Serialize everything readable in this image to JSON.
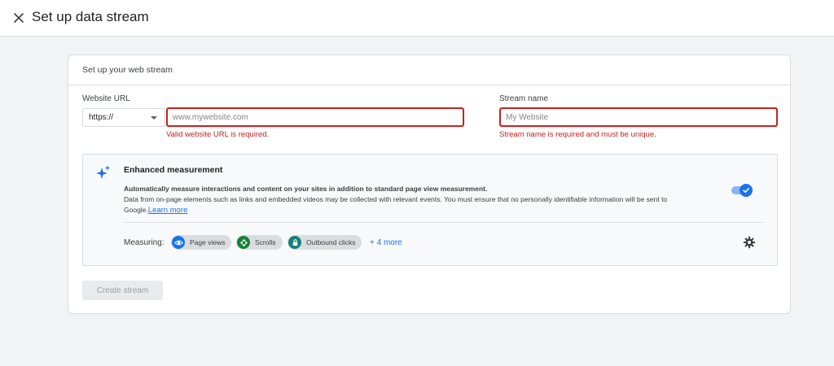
{
  "header": {
    "title": "Set up data stream",
    "close_icon": "close-icon"
  },
  "card": {
    "title": "Set up your web stream",
    "website_url": {
      "label": "Website URL",
      "protocol": "https://",
      "placeholder": "www.mywebsite.com",
      "error": "Valid website URL is required."
    },
    "stream_name": {
      "label": "Stream name",
      "placeholder": "My Website",
      "error": "Stream name is required and must be unique."
    },
    "enhanced": {
      "title": "Enhanced measurement",
      "desc_bold": "Automatically measure interactions and content on your sites in addition to standard page view measurement.",
      "desc": "Data from on-page elements such as links and embedded videos may be collected with relevant events. You must ensure that no personally identifiable information will be sent to Google.",
      "learn_more": "Learn more",
      "toggle_on": true,
      "measuring_label": "Measuring:",
      "chips": [
        {
          "label": "Page views",
          "icon": "eye-icon",
          "color": "#1a73e8"
        },
        {
          "label": "Scrolls",
          "icon": "scroll-icon",
          "color": "#188038"
        },
        {
          "label": "Outbound clicks",
          "icon": "lock-icon",
          "color": "#12837a"
        }
      ],
      "more": "+ 4 more"
    },
    "create_button": "Create stream"
  },
  "colors": {
    "error": "#c5221f",
    "accent": "#1a73e8"
  }
}
